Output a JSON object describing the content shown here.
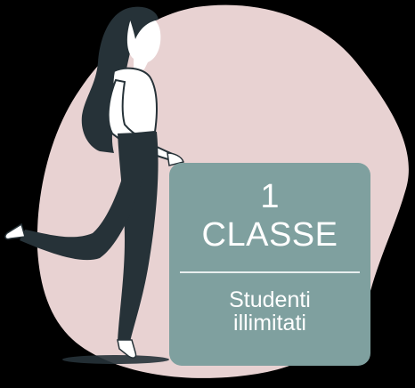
{
  "card": {
    "number": "1",
    "title": "CLASSE",
    "subtitle_line1": "Studenti",
    "subtitle_line2": "illimitati"
  },
  "colors": {
    "background": "#000000",
    "blob": "#e8d2d2",
    "card": "#7fa09f",
    "figure_dark": "#263238",
    "skin": "#ffffff"
  }
}
